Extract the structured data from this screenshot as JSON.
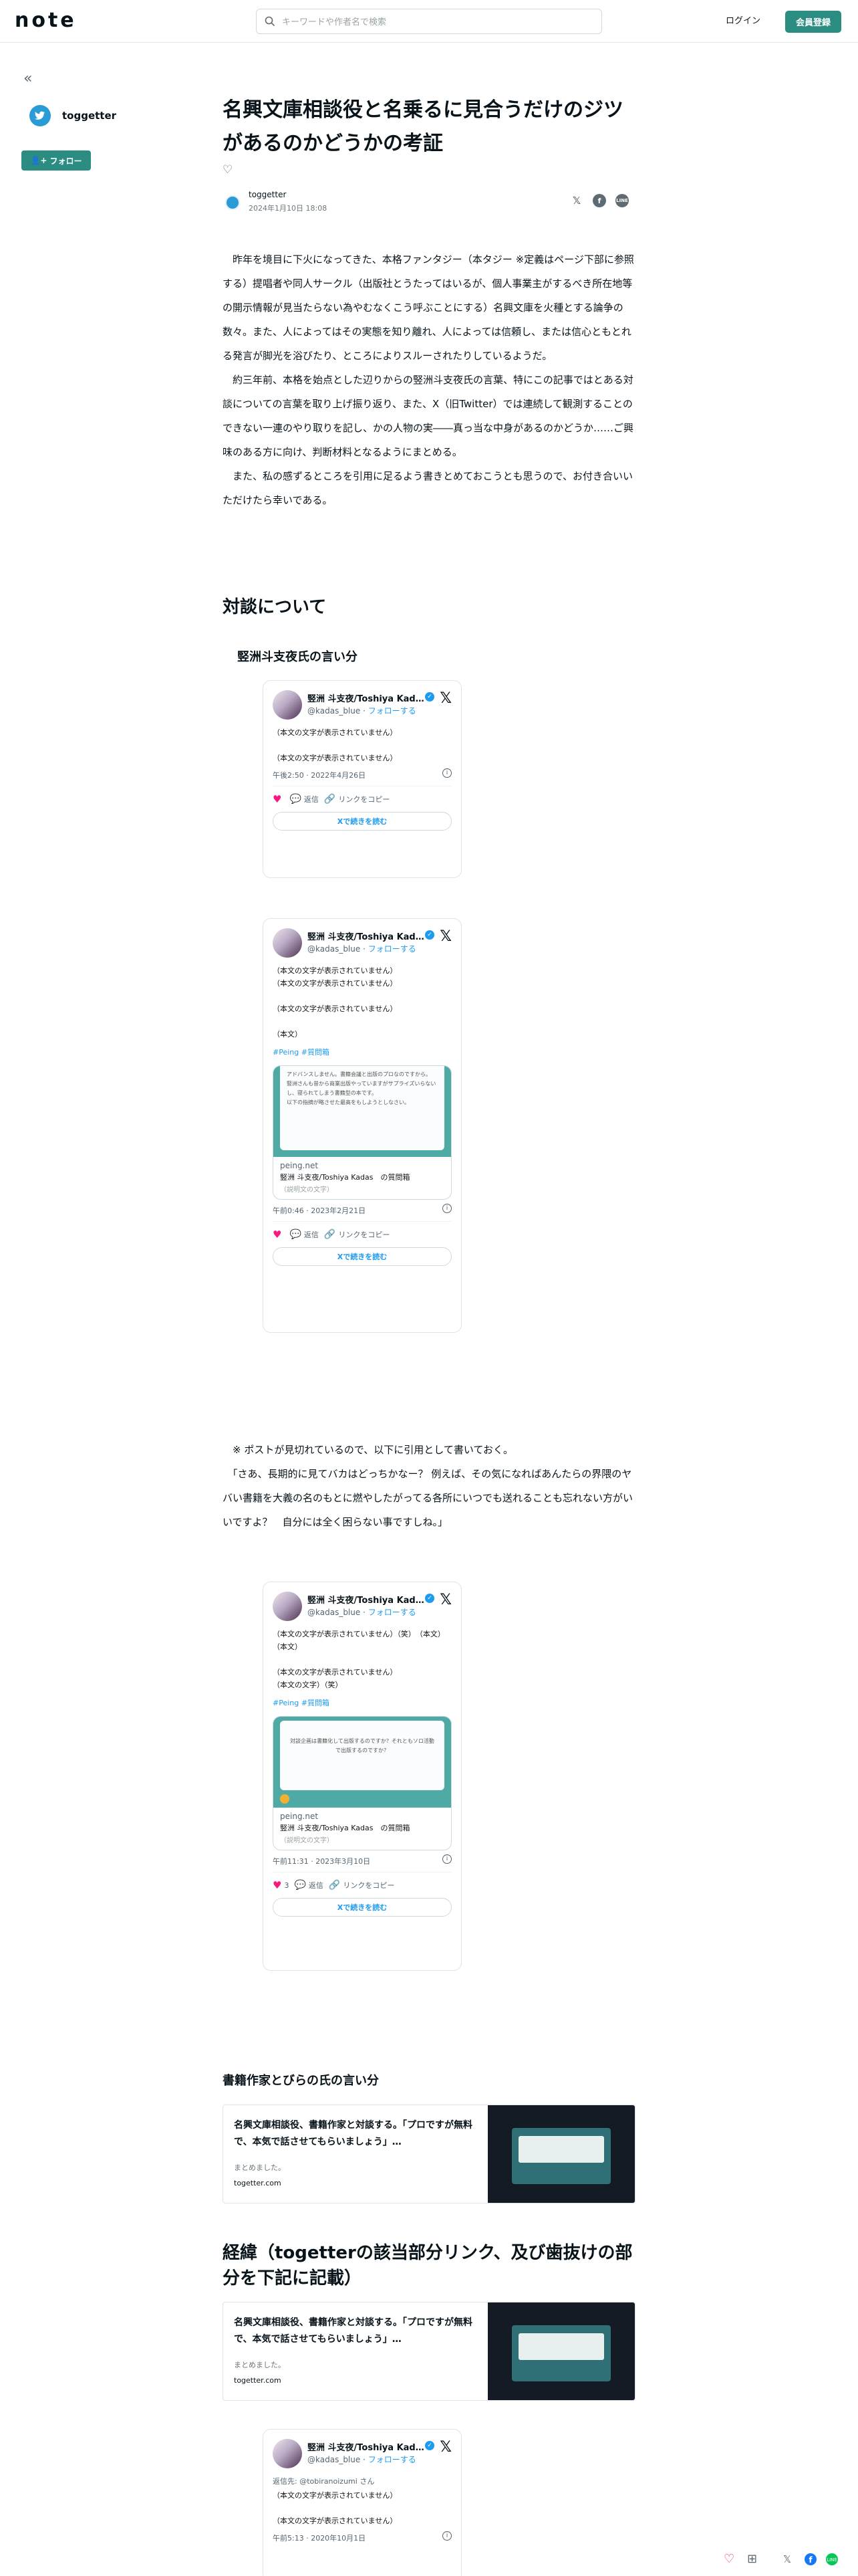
{
  "header": {
    "logo": "note",
    "search_placeholder": "キーワードや作者名で検索",
    "login": "ログイン",
    "signup": "会員登録"
  },
  "sidebar": {
    "collapse_icon": "«",
    "name": "toggetter",
    "follow": "フォロー"
  },
  "article": {
    "title": "名興文庫相談役と名乗るに見合うだけのジツがあるのかどうかの考証",
    "author": "toggetter",
    "date": "2024年1月10日 18:08",
    "intro": [
      "　昨年を境目に下火になってきた、本格ファンタジー（本タジー ※定義はページ下部に参照する）提唱者や同人サークル（出版社とうたってはいるが、個人事業主がするべき所在地等の開示情報が見当たらない為やむなくこう呼ぶことにする）名興文庫を火種とする論争の数々。また、人によってはその実態を知り離れ、人によっては信頼し、または信心ともとれる発言が脚光を浴びたり、ところによりスルーされたりしているようだ。",
      "　約三年前、本格を始点とした辺りからの竪洲斗支夜氏の言葉、特にこの記事ではとある対談についての言葉を取り上げ振り返り、また、X（旧Twitter）では連続して観測することのできない一連のやり取りを記し、かの人物の実――真っ当な中身があるのかどうか……ご興味のある方に向け、判断材料となるようにまとめる。",
      "　また、私の感ずるところを引用に足るよう書きとめておこうとも思うので、お付き合いいただけたら幸いである。"
    ],
    "section1": "対談について",
    "sub1": "竪洲斗支夜氏の言い分",
    "note_quote": "　※ ポストが見切れているので、以下に引用として書いておく。\n　「さあ、長期的に見てバカはどっちかなー？ 例えば、その気になればあんたらの界隈のヤバい書籍を大義の名のもとに燃やしたがってる各所にいつでも送れることも忘れない方がいいですよ？　自分には全く困らない事ですしね。」",
    "sub2": "書籍作家とびらの氏の言い分",
    "section2": "経緯（togetterの該当部分リンク、及び歯抜けの部分を下記に記載）"
  },
  "tweets": [
    {
      "name": "竪洲 斗支夜/Toshiya Kadas…",
      "handle": "@kadas_blue",
      "follow": "フォローする",
      "text": "（本文の文字が表示されていません）\n\n（本文の文字が表示されていません）",
      "time": "午後2:50 · 2022年4月26日",
      "likes": "",
      "reply": "返信",
      "copy": "リンクをコピー",
      "read": "Xで続きを読む"
    },
    {
      "name": "竪洲 斗支夜/Toshiya Kadas…",
      "handle": "@kadas_blue",
      "follow": "フォローする",
      "text": "（本文の文字が表示されていません）\n（本文の文字が表示されていません）\n\n（本文の文字が表示されていません）\n\n（本文）",
      "hashtag": "#Peing #質問箱",
      "card_domain": "peing.net",
      "card_title": "竪洲 斗支夜/Toshiya Kadas　の質問箱",
      "card_desc": "（説明文の文字）",
      "card_image_text": "アドバンスしません。書籍会議と出版のプロなのですから。\n竪洲さんも昔から商業出版やっていますがサプライズいらないし、寝られてしまう書籍型の本です。\n以下の指摘が略させた最高をもしようとしなさい。",
      "time": "午前0:46 · 2023年2月21日",
      "likes": "",
      "reply": "返信",
      "copy": "リンクをコピー",
      "read": "Xで続きを読む"
    },
    {
      "name": "竪洲 斗支夜/Toshiya Kadas…",
      "handle": "@kadas_blue",
      "follow": "フォローする",
      "text": "（本文の文字が表示されていません）（笑）　（本文）\n（本文）\n\n（本文の文字が表示されていません）\n（本文の文字）（笑）",
      "hashtag": "#Peing #質問箱",
      "card_domain": "peing.net",
      "card_title": "竪洲 斗支夜/Toshiya Kadas　の質問箱",
      "card_desc": "（説明文の文字）",
      "card_image_text": "対談企画は書籍化して出版するのですか？それともソロ活動で出版するのですか？",
      "time": "午前11:31 · 2023年3月10日",
      "likes": "3",
      "reply": "返信",
      "copy": "リンクをコピー",
      "read": "Xで続きを読む"
    },
    {
      "name": "竪洲 斗支夜/Toshiya Kadas…",
      "handle": "@kadas_blue",
      "follow": "フォローする",
      "reply_to": "返信先: @tobiranoizumi さん",
      "text": "（本文の文字が表示されていません）\n\n（本文の文字が表示されていません）",
      "time": "午前5:13 · 2020年10月1日"
    }
  ],
  "embeds": [
    {
      "title": "名興文庫相談役、書籍作家と対談する。「プロですが無料で、本気で話させてもらいましょう」…",
      "desc": "まとめました。",
      "url": "togetter.com"
    },
    {
      "title": "名興文庫相談役、書籍作家と対談する。「プロですが無料で、本気で話させてもらいましょう」…",
      "desc": "まとめました。",
      "url": "togetter.com"
    }
  ],
  "colors": {
    "brand": "#2b8c82",
    "x_blue": "#1d9bf0",
    "like": "#f91880",
    "toggetter": "#2a9bd6"
  }
}
